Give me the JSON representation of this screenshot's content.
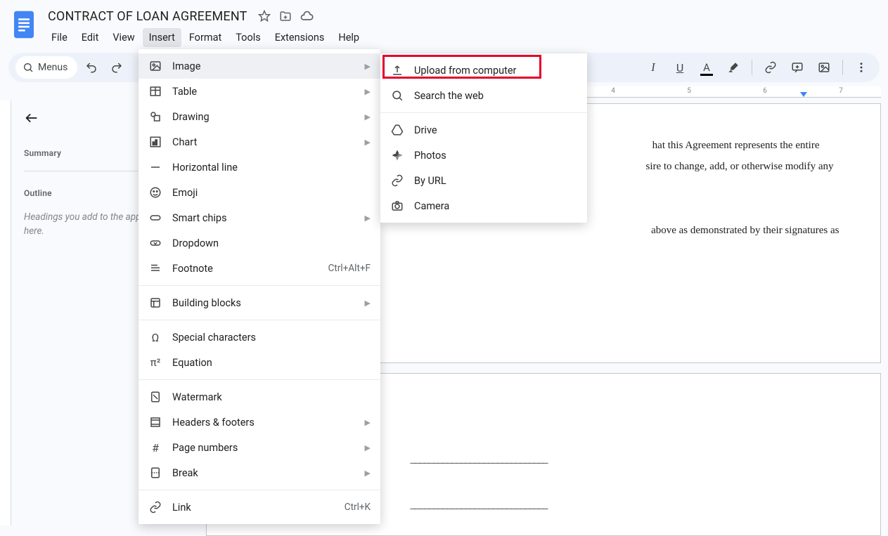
{
  "doc": {
    "title": "CONTRACT OF LOAN AGREEMENT"
  },
  "menubar": {
    "file": "File",
    "edit": "Edit",
    "view": "View",
    "insert": "Insert",
    "format": "Format",
    "tools": "Tools",
    "extensions": "Extensions",
    "help": "Help"
  },
  "toolbar": {
    "menus": "Menus"
  },
  "ruler": {
    "n4": "4",
    "n5": "5",
    "n6": "6",
    "n7": "7"
  },
  "outline": {
    "summary": "Summary",
    "outline": "Outline",
    "hint": "Headings you add to the appear here."
  },
  "insert_menu": {
    "image": "Image",
    "table": "Table",
    "drawing": "Drawing",
    "chart": "Chart",
    "horizontal_line": "Horizontal line",
    "emoji": "Emoji",
    "smart_chips": "Smart chips",
    "dropdown": "Dropdown",
    "footnote": "Footnote",
    "footnote_sc": "Ctrl+Alt+F",
    "building_blocks": "Building blocks",
    "special_chars": "Special characters",
    "equation": "Equation",
    "watermark": "Watermark",
    "headers_footers": "Headers & footers",
    "page_numbers": "Page numbers",
    "break": "Break",
    "link": "Link",
    "link_sc": "Ctrl+K"
  },
  "image_submenu": {
    "upload": "Upload from computer",
    "search_web": "Search the web",
    "drive": "Drive",
    "photos": "Photos",
    "by_url": "By URL",
    "camera": "Camera"
  },
  "doc_body": {
    "p1_frag": "hat this Agreement represents the entire",
    "p2_frag": "sire to change, add, or otherwise modify any",
    "p3_frag": "above as demonstrated by their signatures as",
    "sig_line": "______________________________"
  }
}
